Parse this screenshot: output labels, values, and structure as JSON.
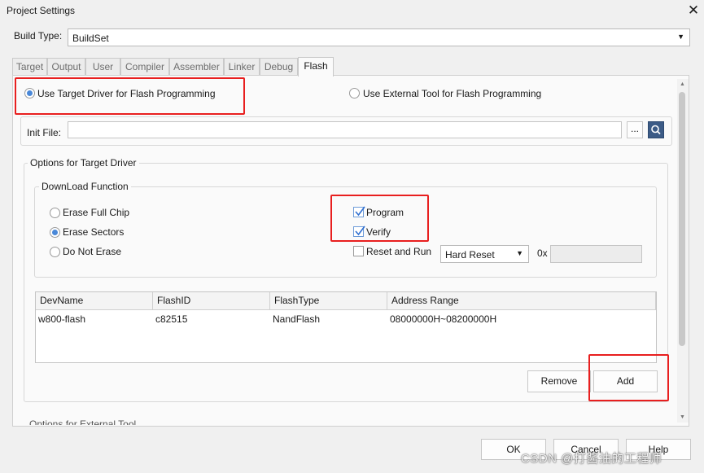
{
  "window": {
    "title": "Project Settings",
    "close_glyph": "✕"
  },
  "build_type": {
    "label": "Build Type:",
    "value": "BuildSet"
  },
  "tabs": [
    {
      "label": "Target"
    },
    {
      "label": "Output"
    },
    {
      "label": "User"
    },
    {
      "label": "Compiler"
    },
    {
      "label": "Assembler"
    },
    {
      "label": "Linker"
    },
    {
      "label": "Debug"
    },
    {
      "label": "Flash"
    }
  ],
  "active_tab": "Flash",
  "flash": {
    "use_target_driver": "Use Target Driver for Flash Programming",
    "use_external_tool": "Use External Tool for Flash Programming",
    "init_file_label": "Init File:",
    "init_file_value": "",
    "browse_label": "...",
    "options_title": "Options for Target Driver",
    "download_title": "DownLoad Function",
    "erase_full_chip": "Erase Full Chip",
    "erase_sectors": "Erase Sectors",
    "do_not_erase": "Do Not Erase",
    "program": "Program",
    "verify": "Verify",
    "reset_and_run": "Reset and Run",
    "reset_type": "Hard Reset",
    "hex_prefix": "0x",
    "hex_value": "",
    "table": {
      "columns": [
        "DevName",
        "FlashID",
        "FlashType",
        "Address Range"
      ],
      "rows": [
        [
          "w800-flash",
          "c82515",
          "NandFlash",
          "08000000H~08200000H"
        ]
      ]
    },
    "remove_label": "Remove",
    "add_label": "Add",
    "next_section_partial": "Options for External Tool"
  },
  "footer": {
    "ok": "OK",
    "cancel": "Cancel",
    "help": "Help"
  },
  "watermark": "CSDN @打酱油的工程师",
  "state": {
    "download_mode": "use_target_driver",
    "erase_mode": "erase_sectors",
    "program_checked": true,
    "verify_checked": true,
    "reset_and_run_checked": false
  },
  "colors": {
    "highlight_box": "#e81f1f",
    "accent": "#4a88d8"
  }
}
